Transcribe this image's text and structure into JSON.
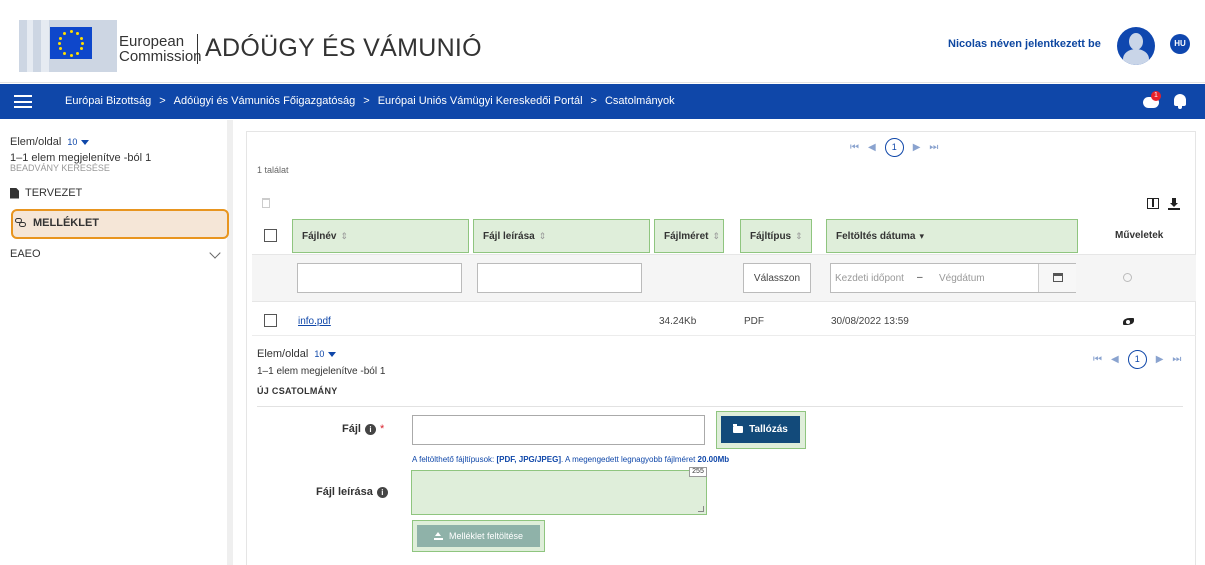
{
  "header": {
    "commission_line1": "European",
    "commission_line2": "Commission",
    "site_title": "ADÓÜGY ÉS VÁMUNIÓ",
    "user_text": "Nicolas néven jelentkezett be",
    "language": "HU"
  },
  "nav": {
    "breadcrumb": [
      "Európai Bizottság",
      "Adóügyi és Vámuniós Főigazgatóság",
      "Európai Uniós Vámügyi Kereskedői Portál",
      "Csatolmányok"
    ],
    "separator": ">",
    "notification_count": "1"
  },
  "sidebar": {
    "per_page_label": "Elem/oldal",
    "per_page_value": "10",
    "count_text": "1–1 elem megjelenítve -ból 1",
    "ghost_text": "BEADVÁNY KERESÉSE",
    "items": [
      {
        "label": "TERVEZET"
      },
      {
        "label": "MELLÉKLET"
      },
      {
        "label": "EAEO"
      }
    ]
  },
  "table": {
    "results": "1 találat",
    "pager_current": "1",
    "columns": [
      {
        "label": "Fájlnév",
        "sort": "⇕"
      },
      {
        "label": "Fájl leírása",
        "sort": "⇕"
      },
      {
        "label": "Fájlméret",
        "sort": "⇕"
      },
      {
        "label": "Fájltípus",
        "sort": "⇕"
      },
      {
        "label": "Feltöltés dátuma",
        "sort": "▾"
      },
      {
        "label": "Műveletek"
      }
    ],
    "filters": {
      "type_select": "Válasszon",
      "date_from_placeholder": "Kezdeti időpont",
      "date_dash": "–",
      "date_to_placeholder": "Végdátum"
    },
    "rows": [
      {
        "name": "info.pdf",
        "size": "34.24Kb",
        "type": "PDF",
        "date": "30/08/2022 13:59"
      }
    ],
    "per_page_label": "Elem/oldal",
    "per_page_value": "10",
    "count_text": "1–1 elem megjelenítve -ból 1"
  },
  "form": {
    "section_title": "ÚJ CSATOLMÁNY",
    "file_label": "Fájl",
    "required_mark": "*",
    "browse_label": "Tallózás",
    "hint_prefix": "A feltölthető fájltípusok:",
    "hint_types": "[PDF, JPG/JPEG]",
    "hint_middle": ". A megengedett legnagyobb fájlméret",
    "hint_size": "20.00Mb",
    "desc_label": "Fájl leírása",
    "char_counter": "255",
    "upload_label": "Melléklet feltöltése"
  }
}
